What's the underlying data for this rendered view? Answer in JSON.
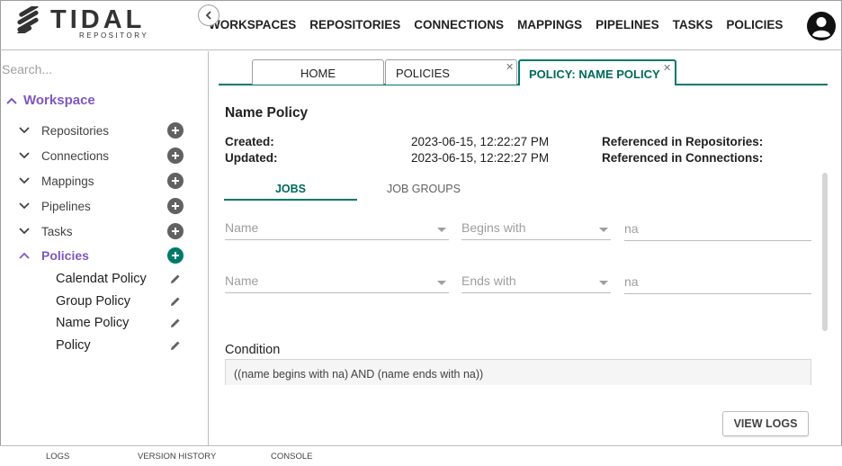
{
  "brand": {
    "name": "TIDAL",
    "sub": "REPOSITORY",
    "logo_icon": "tidal-stripes-logo"
  },
  "nav": [
    "WORKSPACES",
    "REPOSITORIES",
    "CONNECTIONS",
    "MAPPINGS",
    "PIPELINES",
    "TASKS",
    "POLICIES"
  ],
  "user": {
    "icon": "account-circle-icon"
  },
  "sidebar": {
    "search_placeholder": "Search...",
    "workspace_label": "Workspace",
    "items": [
      {
        "label": "Repositories",
        "expanded": false
      },
      {
        "label": "Connections",
        "expanded": false
      },
      {
        "label": "Mappings",
        "expanded": false
      },
      {
        "label": "Pipelines",
        "expanded": false
      },
      {
        "label": "Tasks",
        "expanded": false
      },
      {
        "label": "Policies",
        "expanded": true
      }
    ],
    "policies": [
      "Calendat Policy",
      "Group Policy",
      "Name Policy",
      "Policy"
    ]
  },
  "tabs": [
    {
      "label": "HOME",
      "closable": false
    },
    {
      "label": "POLICIES",
      "closable": true
    },
    {
      "label": "POLICY: NAME POLICY",
      "closable": true,
      "active": true
    }
  ],
  "detail": {
    "title": "Name Policy",
    "created_label": "Created:",
    "created_value": "2023-06-15, 12:22:27 PM",
    "updated_label": "Updated:",
    "updated_value": "2023-06-15, 12:22:27 PM",
    "ref_repos": "Referenced in Repositories:",
    "ref_conns": "Referenced in Connections:",
    "subtabs": {
      "jobs": "JOBS",
      "job_groups": "JOB GROUPS",
      "active": "JOBS"
    },
    "rules": [
      {
        "field": "Name",
        "operator": "Begins with",
        "value": "na"
      },
      {
        "field": "Name",
        "operator": "Ends with",
        "value": "na"
      }
    ],
    "condition_label": "Condition",
    "condition_text": "((name begins with na) AND (name ends with na))",
    "view_logs": "VIEW LOGS"
  },
  "footer": {
    "logs": "LOGS",
    "version_history": "VERSION HISTORY",
    "console": "CONSOLE"
  },
  "colors": {
    "accent": "#00796b",
    "workspace_purple": "#7e57c2",
    "plus_gray": "#616161"
  }
}
